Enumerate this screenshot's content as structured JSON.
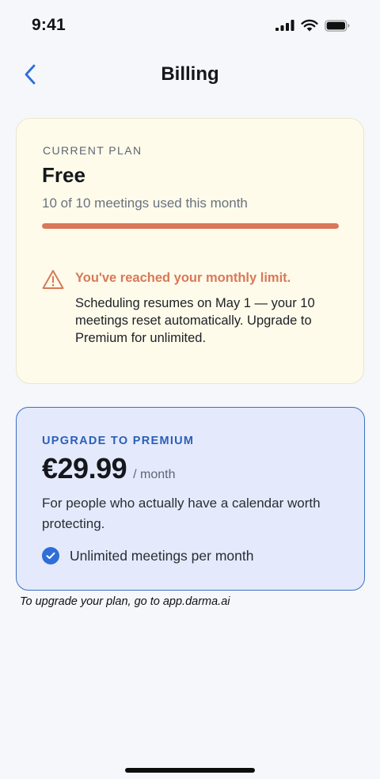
{
  "status_bar": {
    "time": "9:41",
    "icons": [
      "cellular-signal-icon",
      "wifi-icon",
      "battery-icon"
    ]
  },
  "nav": {
    "title": "Billing",
    "back_icon": "chevron-left-icon"
  },
  "current_plan": {
    "eyebrow": "CURRENT PLAN",
    "name": "Free",
    "usage_text": "10 of 10 meetings used this month",
    "usage_fraction": 1.0,
    "warning": {
      "icon": "warning-triangle-icon",
      "title": "You've reached your monthly limit.",
      "body": "Scheduling resumes on May 1 — your 10 meetings reset automatically. Upgrade to Premium for unlimited."
    }
  },
  "upgrade": {
    "eyebrow": "UPGRADE TO PREMIUM",
    "price": "€29.99",
    "period": "/ month",
    "description": "For people who actually have a calendar worth protecting.",
    "feature": {
      "icon": "check-circle-icon",
      "label": "Unlimited meetings per month"
    }
  },
  "hint": "To upgrade your plan, go to app.darma.ai",
  "colors": {
    "accent": "#2f6ed8",
    "warning": "#d9785a",
    "plan_card_bg": "#fefbea",
    "upgrade_card_bg": "#e4eafb",
    "page_bg": "#f6f7fb"
  }
}
